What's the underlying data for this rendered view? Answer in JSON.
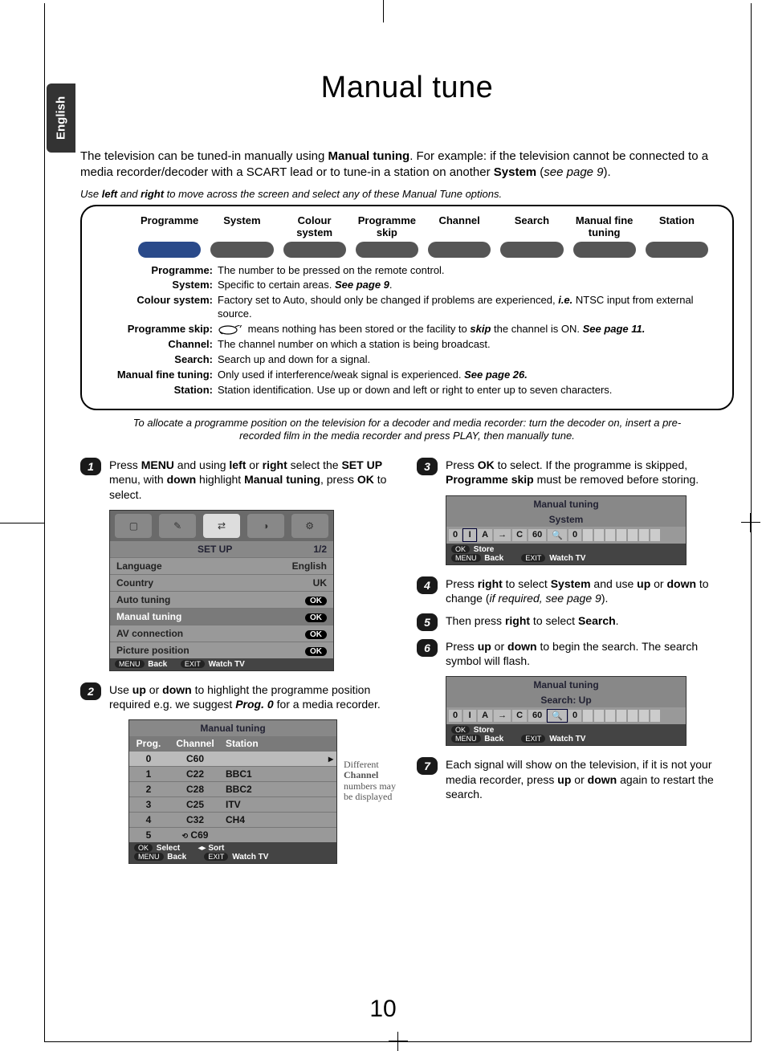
{
  "lang_tab": "English",
  "title": "Manual tune",
  "intro_parts": {
    "a": "The television can be tuned-in manually using ",
    "b": "Manual tuning",
    "c": ". For example: if the television cannot be connected to a media recorder/decoder with a SCART lead or to tune-in a station on another ",
    "d": "System",
    "e": " (",
    "f": "see page 9",
    "g": ")."
  },
  "intro_note_parts": {
    "a": "Use ",
    "b": "left",
    "c": " and ",
    "d": "right",
    "e": " to move across the screen and select any of these Manual Tune options."
  },
  "info_tabs": [
    "Programme",
    "System",
    "Colour system",
    "Programme skip",
    "Channel",
    "Search",
    "Manual fine tuning",
    "Station"
  ],
  "defs": [
    {
      "label": "Programme:",
      "html": "The number to be pressed on the remote control."
    },
    {
      "label": "System:",
      "html": "Specific to certain areas. <b><i>See page 9</i></b>."
    },
    {
      "label": "Colour system:",
      "html": "Factory set to Auto, should only be changed if problems are experienced, <b><i>i.e.</i></b> NTSC input from external source."
    },
    {
      "label": "Programme skip:",
      "html": "<span class='skip-ico'><svg viewBox='0 0 34 12'><ellipse cx='13' cy='6' rx='11' ry='5' fill='none' stroke='#000' stroke-width='1.2'/><path d='M3 9 L6 11 M22 2 L30 -1 L28 3' fill='none' stroke='#000' stroke-width='1'/></svg></span> means nothing has been stored or the facility to <b><i>skip</i></b> the channel is ON. <b><i>See page 11.</i></b>"
    },
    {
      "label": "Channel:",
      "html": "The channel number on which a station is being broadcast."
    },
    {
      "label": "Search:",
      "html": "Search up and down for a signal."
    },
    {
      "label": "Manual fine tuning:",
      "html": "Only used if interference/weak signal is experienced. <b><i>See page 26.</i></b>"
    },
    {
      "label": "Station:",
      "html": "Station identification. Use up or down and left or right to enter up to seven characters."
    }
  ],
  "alloc_note": "To allocate a programme position on the television for a decoder and media recorder: turn the decoder on, insert a pre-recorded film in the media recorder and press PLAY, then manually tune.",
  "steps": {
    "s1": "Press <b>MENU</b> and using <b>left</b> or <b>right</b> select the <b>SET UP</b> menu, with <b>down</b> highlight <b>Manual tuning</b>, press <b>OK</b> to select.",
    "s2": "Use <b>up</b> or <b>down</b> to highlight the programme position required e.g. we suggest <b><i>Prog. 0</i></b> for a media recorder.",
    "s3": "Press <b>OK</b> to select. If the programme is skipped, <b>Programme skip</b> must be removed before storing.",
    "s4": "Press <b>right</b> to select <b>System</b> and use <b>up</b> or <b>down</b> to change (<i>if required, see page 9</i>).",
    "s5": "Then press <b>right</b> to select <b>Search</b>.",
    "s6": "Press <b>up</b> or <b>down</b> to begin the search. The search symbol will flash.",
    "s7": "Each signal will show on the television, if it is not your media recorder, press <b>up</b> or <b>down</b> again to restart the search."
  },
  "osd_setup": {
    "title": "SET UP",
    "page": "1/2",
    "rows": [
      {
        "l": "Language",
        "r": "English"
      },
      {
        "l": "Country",
        "r": "UK"
      },
      {
        "l": "Auto tuning",
        "r": "OK"
      },
      {
        "l": "Manual tuning",
        "r": "OK"
      },
      {
        "l": "AV connection",
        "r": "OK"
      },
      {
        "l": "Picture position",
        "r": "OK"
      }
    ],
    "foot_menu": "MENU",
    "foot_back": "Back",
    "foot_exit": "EXIT",
    "foot_watch": "Watch TV"
  },
  "osd_list": {
    "title": "Manual tuning",
    "headers": [
      "Prog.",
      "Channel",
      "Station"
    ],
    "rows": [
      [
        "0",
        "C60",
        ""
      ],
      [
        "1",
        "C22",
        "BBC1"
      ],
      [
        "2",
        "C28",
        "BBC2"
      ],
      [
        "3",
        "C25",
        "ITV"
      ],
      [
        "4",
        "C32",
        "CH4"
      ],
      [
        "5",
        "C69",
        ""
      ]
    ],
    "foot_ok": "OK",
    "foot_select": "Select",
    "foot_sort": "Sort",
    "side_note": "Different <b>Channel</b> numbers may be displayed"
  },
  "osd_sys": {
    "title": "Manual tuning",
    "sub": "System",
    "cells": [
      "0",
      "I",
      "A",
      "→",
      "C",
      "60",
      "🔍",
      "0"
    ],
    "store": "Store"
  },
  "osd_search": {
    "title": "Manual tuning",
    "sub": "Search: Up",
    "cells": [
      "0",
      "I",
      "A",
      "→",
      "C",
      "60",
      "🔍",
      "0"
    ],
    "store": "Store"
  },
  "page_number": "10"
}
